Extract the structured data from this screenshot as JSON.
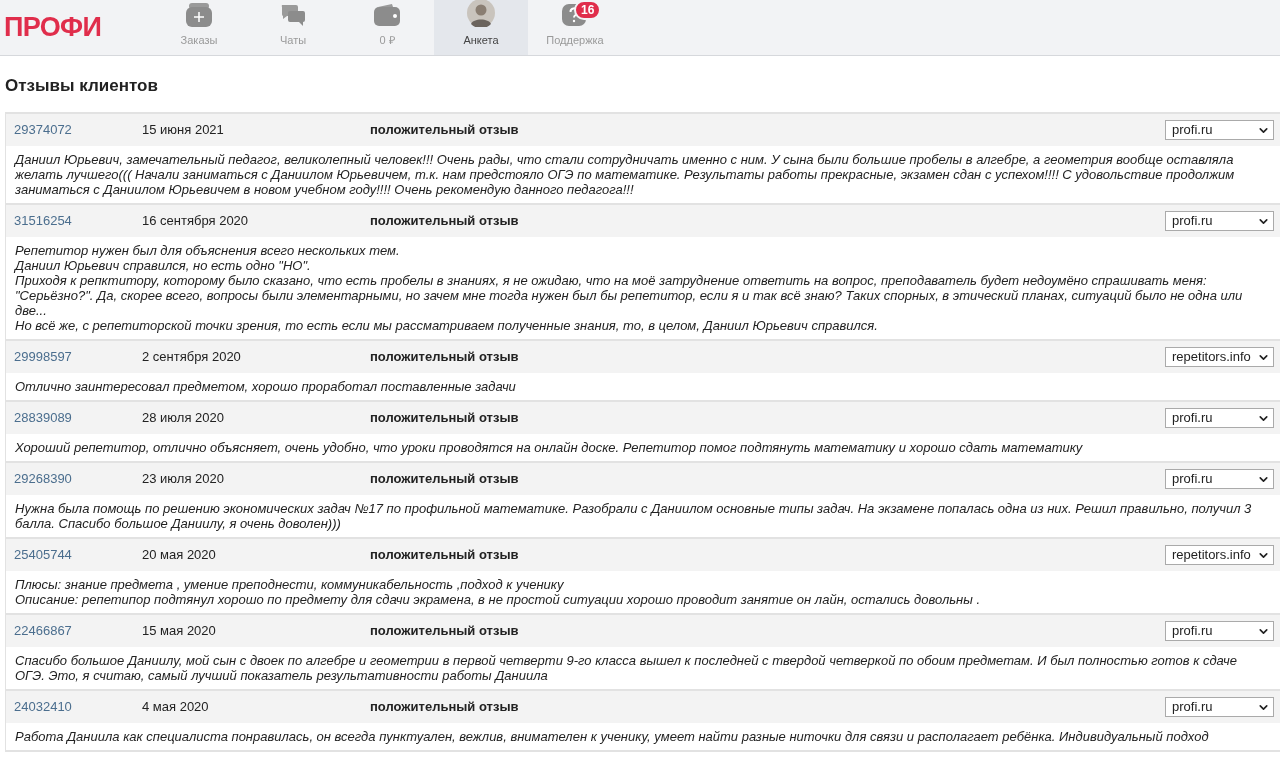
{
  "logo": "ПРОФИ",
  "nav": [
    {
      "kind": "orders",
      "label": "Заказы",
      "selected": false
    },
    {
      "kind": "chats",
      "label": "Чаты",
      "selected": false
    },
    {
      "kind": "wallet",
      "label": "0 ₽",
      "selected": false
    },
    {
      "kind": "profile",
      "label": "Анкета",
      "selected": true
    },
    {
      "kind": "support",
      "label": "Поддержка",
      "selected": false,
      "badge": "16"
    }
  ],
  "title": "Отзывы клиентов",
  "reviews": [
    {
      "id": "29374072",
      "date": "15 июня 2021",
      "type": "положительный отзыв",
      "source": "profi.ru",
      "text": [
        "Даниил Юрьевич, замечательный педагог, великолепный человек!!! Очень рады, что стали сотрудничать именно с ним. У сына были большие пробелы в алгебре, а геометрия вообще оставляла желать лучшего((( Начали заниматься с Даниилом Юрьевичем, т.к. нам предстояло ОГЭ по математике. Результаты работы прекрасные, экзамен сдан с успехом!!!! С удовольствие продолжим заниматься с Даниилом Юрьевичем в новом учебном году!!!! Очень рекомендую данного педагога!!!"
      ]
    },
    {
      "id": "31516254",
      "date": "16 сентября 2020",
      "type": "положительный отзыв",
      "source": "profi.ru",
      "text": [
        "Репетитор нужен был для объяснения всего нескольких тем.",
        "Даниил Юрьевич справился, но есть одно \"НО\".",
        "Приходя к репктитору, которому было сказано, что есть пробелы в знаниях, я не ожидаю, что на моё затруднение ответить на вопрос, преподаватель будет недоумёно спрашивать меня: \"Серьёзно?\". Да, скорее всего, вопросы были элементарными, но зачем мне тогда нужен был бы репетитор, если я и так всё знаю? Таких спорных, в этический планах, ситуаций было не одна или две...",
        "Но всё же, с репетиторской точки зрения, то есть если мы рассматриваем полученные знания, то, в целом, Даниил Юрьевич справился."
      ]
    },
    {
      "id": "29998597",
      "date": "2 сентября 2020",
      "type": "положительный отзыв",
      "source": "repetitors.info",
      "text": [
        "Отлично заинтересовал предметом, хорошо проработал поставленные задачи"
      ]
    },
    {
      "id": "28839089",
      "date": "28 июля 2020",
      "type": "положительный отзыв",
      "source": "profi.ru",
      "text": [
        "Хороший репетитор, отлично объясняет, очень удобно, что уроки проводятся на онлайн доске. Репетитор помог подтянуть математику и хорошо сдать математику"
      ]
    },
    {
      "id": "29268390",
      "date": "23 июля 2020",
      "type": "положительный отзыв",
      "source": "profi.ru",
      "text": [
        "Нужна была помощь по решению экономических задач №17 по профильной математике. Разобрали с Даниилом основные типы задач. На экзамене попалась одна из них. Решил правильно, получил 3 балла. Спасибо большое Даниилу, я очень доволен)))"
      ]
    },
    {
      "id": "25405744",
      "date": "20 мая 2020",
      "type": "положительный отзыв",
      "source": "repetitors.info",
      "text": [
        "Плюсы: знание предмета , умение преподнести, коммуникабельность ,подход к ученику",
        "Описание: репетипор подтянул хорошо по предмету для сдачи экрамена, в не простой ситуации хорошо проводит занятие он лайн, остались довольны ."
      ]
    },
    {
      "id": "22466867",
      "date": "15 мая 2020",
      "type": "положительный отзыв",
      "source": "profi.ru",
      "text": [
        "Спасибо большое Даниилу, мой сын с двоек по алгебре и геометрии в первой четверти 9-го класса вышел к последней с твердой четверкой по обоим предметам. И был полностью готов к сдаче ОГЭ. Это, я считаю, самый лучший показатель результативности работы Даниила"
      ]
    },
    {
      "id": "24032410",
      "date": "4 мая 2020",
      "type": "положительный отзыв",
      "source": "profi.ru",
      "text": [
        "Работа Даниила как специалиста понравилась, он всегда пунктуален, вежлив, внимателен к ученику, умеет найти разные ниточки для связи и располагает ребёнка. Индивидуальный подход"
      ]
    }
  ]
}
